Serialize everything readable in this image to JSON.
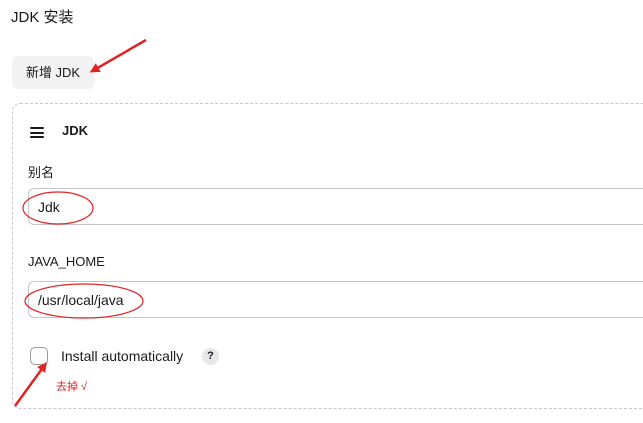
{
  "section": {
    "title": "JDK 安装"
  },
  "toolbar": {
    "add_label": "新增 JDK"
  },
  "jdk_card": {
    "title": "JDK",
    "alias": {
      "label": "别名",
      "value": "Jdk"
    },
    "java_home": {
      "label": "JAVA_HOME",
      "value": "/usr/local/java"
    },
    "install_automatically": {
      "label": "Install automatically",
      "checked": false,
      "help_symbol": "?"
    }
  },
  "annotation": {
    "note": "去掉 √",
    "color": "#e02424"
  }
}
